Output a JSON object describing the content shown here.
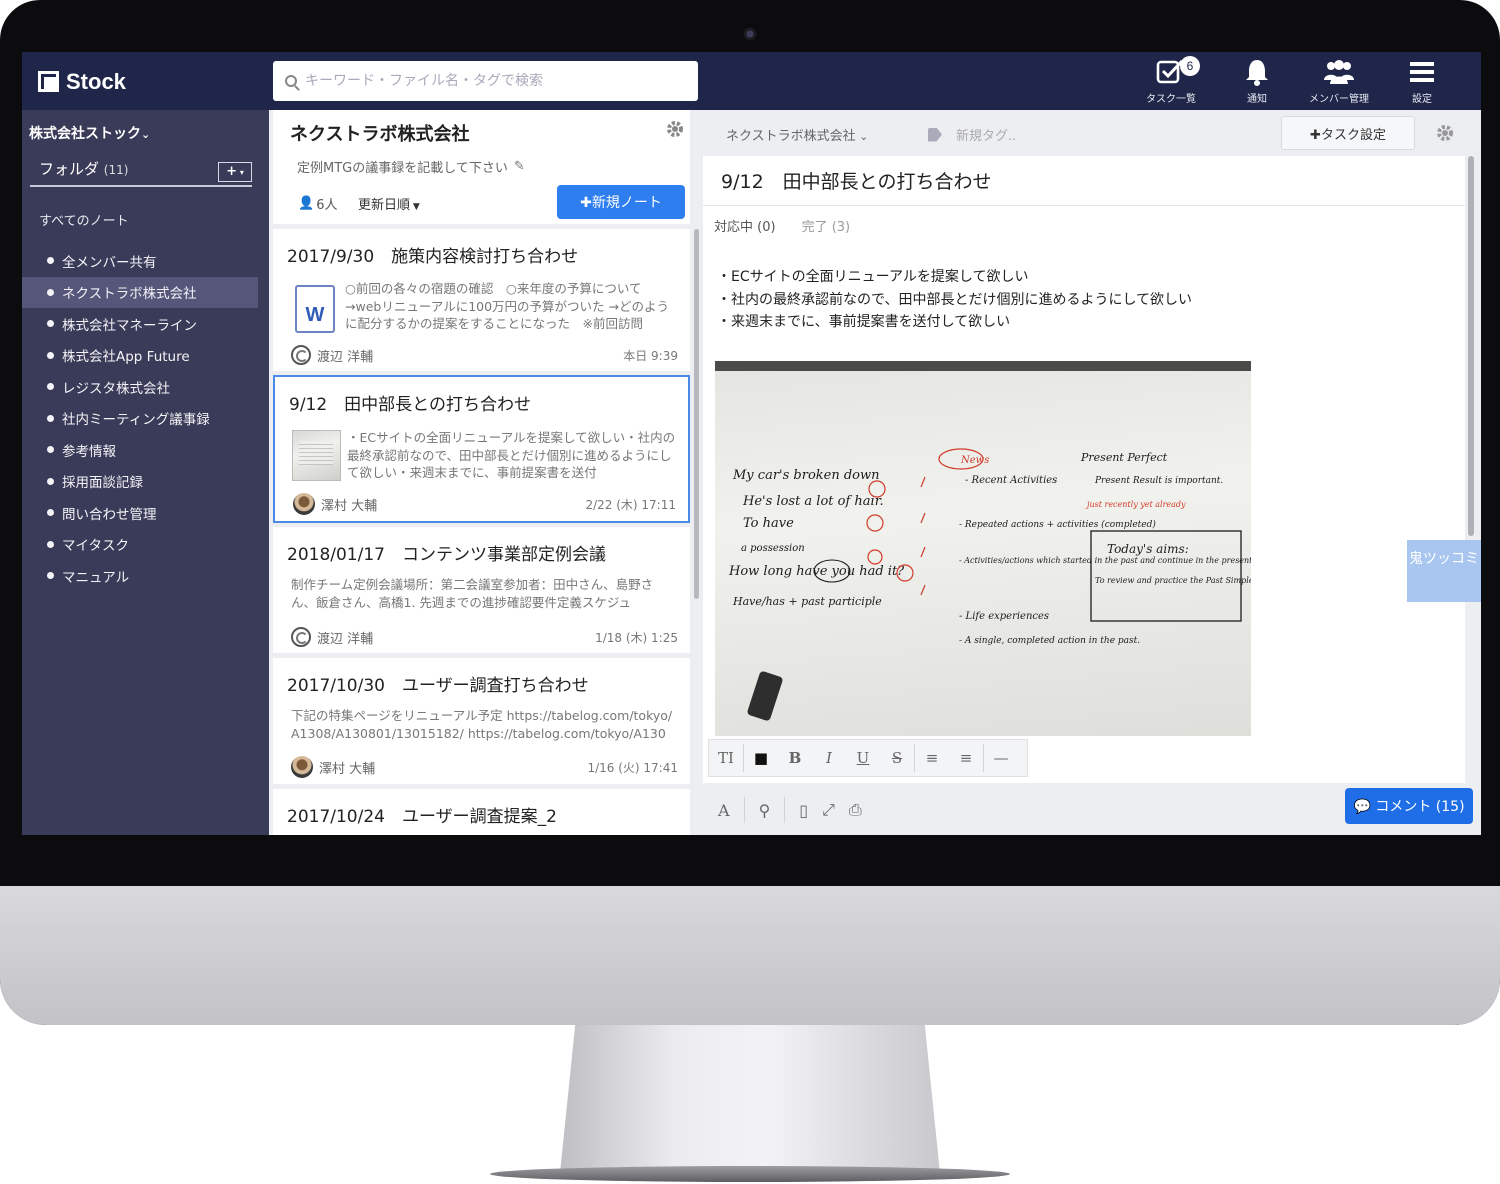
{
  "app": {
    "logo_text": "Stock"
  },
  "search": {
    "placeholder": "キーワード・ファイル名・タグで検索"
  },
  "topnav": {
    "tasks_label": "タスク一覧",
    "tasks_badge": "6",
    "notify_label": "通知",
    "members_label": "メンバー管理",
    "settings_label": "設定"
  },
  "sidebar": {
    "company": "株式会社ストック",
    "folder_label": "フォルダ",
    "folder_count": "(11)",
    "folder_add": "+",
    "all_notes": "すべてのノート",
    "items": [
      {
        "label": "全メンバー共有"
      },
      {
        "label": "ネクストラボ株式会社"
      },
      {
        "label": "株式会社マネーライン"
      },
      {
        "label": "株式会社App Future"
      },
      {
        "label": "レジスタ株式会社"
      },
      {
        "label": "社内ミーティング議事録"
      },
      {
        "label": "参考情報"
      },
      {
        "label": "採用面談記録"
      },
      {
        "label": "問い合わせ管理"
      },
      {
        "label": "マイタスク"
      },
      {
        "label": "マニュアル"
      }
    ],
    "active_index": 1
  },
  "folder_head": {
    "title": "ネクストラボ株式会社",
    "description": "定例MTGの議事録を記載して下さい",
    "members": "6人",
    "sort": "更新日順",
    "new_note": "新規ノート"
  },
  "notes": [
    {
      "title": "2017/9/30　施策内容検討打ち合わせ",
      "body": "○前回の各々の宿題の確認　○来年度の予算について →webリニューアルに100万円の予算がついた →どのように配分するかの提案をすることになった　※前回訪問",
      "author": "渡辺 洋輔",
      "date": "本日 9:39",
      "attachment": "W"
    },
    {
      "title": "9/12　田中部長との打ち合わせ",
      "body": "・ECサイトの全面リニューアルを提案して欲しい・社内の最終承認前なので、田中部長とだけ個別に進めるようにして欲しい・来週末までに、事前提案書を送付",
      "author": "澤村 大輔",
      "date": "2/22 (木) 17:11"
    },
    {
      "title": "2018/01/17　コンテンツ事業部定例会議",
      "body": "制作チーム定例会議場所：第二会議室参加者：田中さん、島野さん、飯倉さん、高橋1. 先週までの進捗確認要件定義スケジュ",
      "author": "渡辺 洋輔",
      "date": "1/18 (木) 1:25"
    },
    {
      "title": "2017/10/30　ユーザー調査打ち合わせ",
      "body": "下記の特集ページをリニューアル予定 https://tabelog.com/tokyo/A1308/A130801/13015182/ https://tabelog.com/tokyo/A130",
      "author": "澤村 大輔",
      "date": "1/16 (火) 17:41"
    },
    {
      "title": "2017/10/24　ユーザー調査提案_2"
    }
  ],
  "detail": {
    "breadcrumb": "ネクストラボ株式会社",
    "tag_placeholder": "新規タグ..",
    "task_button": "タスク設定",
    "title": "9/12　田中部長との打ち合わせ",
    "status_open": "対応中 (0)",
    "status_done": "完了 (3)",
    "lines": [
      "・ECサイトの全面リニューアルを提案して欲しい",
      "・社内の最終承認前なので、田中部長とだけ個別に進めるようにして欲しい",
      "・来週末までに、事前提案書を送付して欲しい"
    ],
    "whiteboard_left": [
      "My car's broken down",
      "He's lost a lot of hair.",
      "To have",
      "a possession",
      "How long have you had it?",
      "Have/has + past participle"
    ],
    "whiteboard_mid": [
      "News",
      "- Recent Activities",
      "- Repeated actions + activities (completed)",
      "- Activities/actions which started in the past and continue in the present",
      "- Life experiences",
      "- A single, completed action in the past."
    ],
    "whiteboard_right": [
      "Present Perfect",
      "Present Result is important.",
      "just recently yet already",
      "Today's aims:",
      "To review and practice the Past Simple and Present Perfect"
    ],
    "format_tools": [
      "TI",
      "■",
      "B",
      "I",
      "U",
      "S",
      "≡",
      "≡",
      "—"
    ],
    "comment_button": "コメント (15)",
    "side_tab": "鬼ツッコミ"
  },
  "colors": {
    "topbar": "#1f2649",
    "sidebar": "#3a3b58",
    "accent_blue": "#2e7ef0"
  }
}
